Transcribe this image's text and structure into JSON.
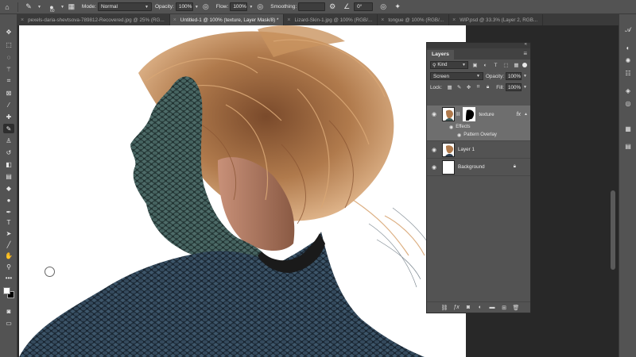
{
  "options_bar": {
    "brush_size": "60",
    "mode_label": "Mode:",
    "mode_value": "Normal",
    "opacity_label": "Opacity:",
    "opacity_value": "100%",
    "flow_label": "Flow:",
    "flow_value": "100%",
    "smoothing_label": "Smoothing:",
    "smoothing_value": "",
    "angle_value": "0°"
  },
  "tabs": [
    {
      "label": "pexels-daria-shevtsova-789812-Recovered.jpg @ 25% (RG..."
    },
    {
      "label": "Untitled-1 @ 100% (texture, Layer Mask/8) *"
    },
    {
      "label": "Lizard-Skin-1.jpg @ 100% (RGB/..."
    },
    {
      "label": "tongue @ 100% (RGB/..."
    },
    {
      "label": "WIP.psd @ 33.3% (Layer 2, RGB..."
    }
  ],
  "layers_panel": {
    "tab_label": "Layers",
    "filter_kind": "Kind",
    "blend_mode": "Screen",
    "opacity_label": "Opacity:",
    "opacity_value": "100%",
    "lock_label": "Lock:",
    "fill_label": "Fill:",
    "fill_value": "100%",
    "layers": [
      {
        "name": "texture",
        "fx": "fx"
      },
      {
        "name": "Layer 1"
      },
      {
        "name": "Background"
      }
    ],
    "effects_label": "Effects",
    "pattern_overlay_label": "Pattern Overlay"
  },
  "colors": {
    "ui_panel": "#535353",
    "ui_dark": "#282828",
    "selected_layer": "#6e6e6e",
    "lizard_texture": "#3e5a58",
    "hair": "#b07a4c"
  },
  "icons": {
    "left_toolbar": [
      "move-icon",
      "marquee-icon",
      "lasso-icon",
      "magic-wand-icon",
      "crop-icon",
      "eyedropper-icon",
      "healing-icon",
      "brush-icon",
      "stamp-icon",
      "history-brush-icon",
      "eraser-icon",
      "gradient-icon",
      "blur-icon",
      "dodge-icon",
      "pen-icon",
      "type-icon",
      "path-select-icon",
      "line-icon",
      "hand-icon",
      "zoom-icon",
      "more-icon"
    ],
    "right_dock": [
      "character-icon",
      "adjustments-icon",
      "sun-icon",
      "properties-icon",
      "layers-icon",
      "channels-icon",
      "paths-icon"
    ]
  }
}
